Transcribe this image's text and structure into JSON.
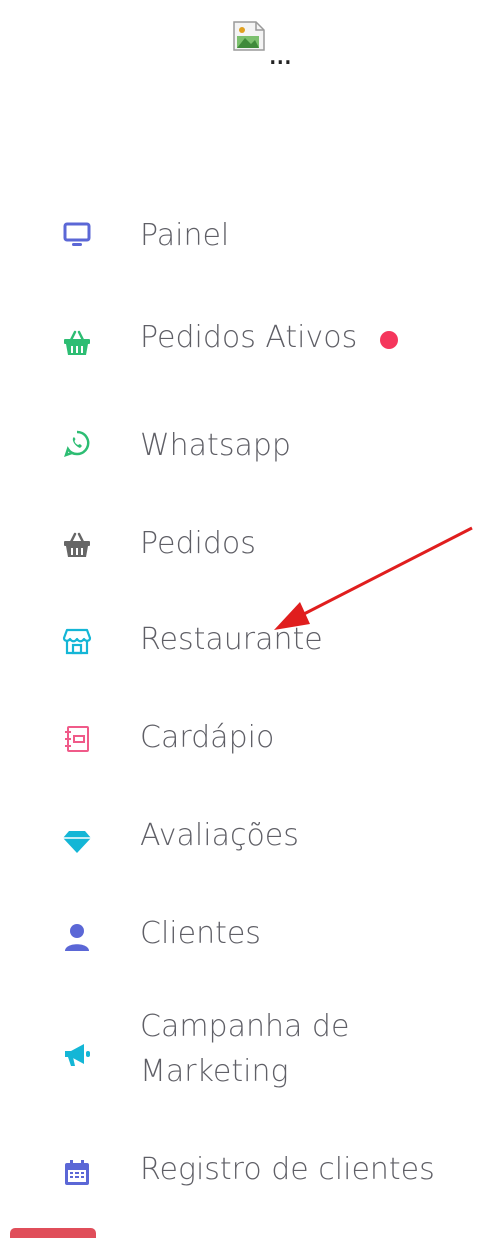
{
  "sidebar": {
    "items": [
      {
        "key": "painel",
        "label": "Painel",
        "icon": "monitor-icon",
        "color": "#5b67d6"
      },
      {
        "key": "pedidos-ativos",
        "label": "Pedidos Ativos",
        "icon": "basket-icon",
        "color": "#2dbd73",
        "badge": true
      },
      {
        "key": "whatsapp",
        "label": "Whatsapp",
        "icon": "whatsapp-icon",
        "color": "#2dbd73"
      },
      {
        "key": "pedidos",
        "label": "Pedidos",
        "icon": "basket-icon",
        "color": "#666666"
      },
      {
        "key": "restaurante",
        "label": "Restaurante",
        "icon": "store-icon",
        "color": "#14b6d6"
      },
      {
        "key": "cardapio",
        "label": "Cardápio",
        "icon": "menu-book-icon",
        "color": "#f05a89"
      },
      {
        "key": "avaliacoes",
        "label": "Avaliações",
        "icon": "diamond-icon",
        "color": "#14b6d6"
      },
      {
        "key": "clientes",
        "label": "Clientes",
        "icon": "user-icon",
        "color": "#5b67d6"
      },
      {
        "key": "campanha",
        "label": "Campanha de Marketing",
        "line1": "Campanha de",
        "line2": "Marketing",
        "icon": "megaphone-icon",
        "color": "#14b6d6"
      },
      {
        "key": "registro",
        "label": "Registro de clientes",
        "icon": "calendar-icon",
        "color": "#5b67d6"
      }
    ]
  },
  "colors": {
    "badge": "#f5365c",
    "arrow": "#e01e1e",
    "bottom_bar": "#e04e5a",
    "text": "#5f5f66"
  },
  "logo": {
    "icon": "broken-image-icon",
    "ellipsis": "..."
  }
}
